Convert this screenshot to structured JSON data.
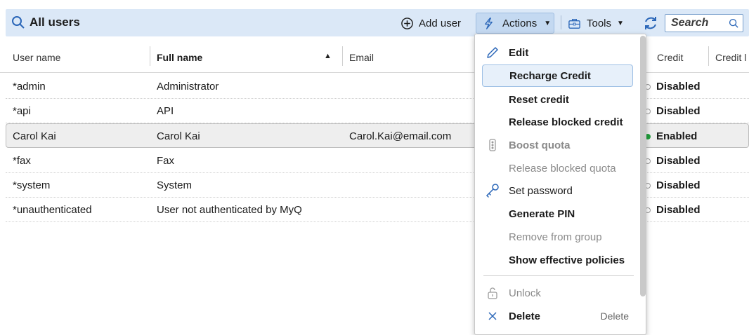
{
  "header": {
    "title": "All users",
    "add_user_label": "Add user",
    "actions_label": "Actions",
    "tools_label": "Tools",
    "search_placeholder": "Search"
  },
  "columns": {
    "user_name": "User name",
    "full_name": "Full name",
    "email": "Email",
    "credit": "Credit",
    "credit_partial": "Credit l"
  },
  "rows": [
    {
      "user_name": "*admin",
      "full_name": "Administrator",
      "email": "",
      "credit": "Disabled",
      "enabled": false
    },
    {
      "user_name": "*api",
      "full_name": "API",
      "email": "",
      "credit": "Disabled",
      "enabled": false
    },
    {
      "user_name": "Carol Kai",
      "full_name": "Carol Kai",
      "email": "Carol.Kai@email.com",
      "credit": "Enabled",
      "enabled": true
    },
    {
      "user_name": "*fax",
      "full_name": "Fax",
      "email": "",
      "credit": "Disabled",
      "enabled": false
    },
    {
      "user_name": "*system",
      "full_name": "System",
      "email": "",
      "credit": "Disabled",
      "enabled": false
    },
    {
      "user_name": "*unauthenticated",
      "full_name": "User not authenticated by MyQ",
      "email": "",
      "credit": "Disabled",
      "enabled": false
    }
  ],
  "menu": {
    "items": [
      {
        "label": "Edit",
        "icon": "pencil-icon",
        "enabled": true
      },
      {
        "label": "Recharge Credit",
        "icon": "",
        "enabled": true
      },
      {
        "label": "Reset credit",
        "icon": "",
        "enabled": true
      },
      {
        "label": "Release blocked credit",
        "icon": "",
        "enabled": true
      },
      {
        "label": "Boost quota",
        "icon": "traffic-light-icon",
        "enabled": false
      },
      {
        "label": "Release blocked quota",
        "icon": "",
        "enabled": false
      },
      {
        "label": "Set password",
        "icon": "key-icon",
        "enabled": true
      },
      {
        "label": "Generate PIN",
        "icon": "",
        "enabled": true
      },
      {
        "label": "Remove from group",
        "icon": "",
        "enabled": false
      },
      {
        "label": "Show effective policies",
        "icon": "",
        "enabled": true
      },
      {
        "label": "Unlock",
        "icon": "unlock-icon",
        "enabled": false
      },
      {
        "label": "Delete",
        "icon": "close-icon",
        "enabled": true,
        "shortcut": "Delete"
      }
    ]
  },
  "colors": {
    "toolbar_bg": "#dbe8f7",
    "actions_bg": "#c4d9f1",
    "enabled_dot": "#1f9e3b",
    "accent": "#2a66b8"
  }
}
